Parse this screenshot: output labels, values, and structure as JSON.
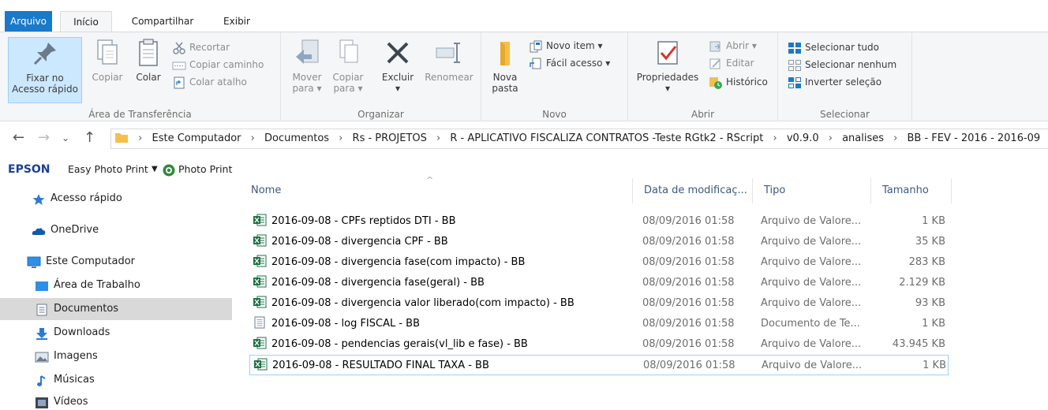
{
  "tabs": [
    "Arquivo",
    "Início",
    "Compartilhar",
    "Exibir"
  ],
  "ribbon": {
    "clipboard": {
      "pin": [
        "Fixar no",
        "Acesso rápido"
      ],
      "copy": "Copiar",
      "paste": "Colar",
      "cut": "Recortar",
      "copy_path": "Copiar caminho",
      "paste_shortcut": "Colar atalho",
      "label": "Área de Transferência"
    },
    "organize": {
      "move": [
        "Mover",
        "para ▾"
      ],
      "copy_to": [
        "Copiar",
        "para ▾"
      ],
      "delete": [
        "Excluir",
        "▾"
      ],
      "rename": "Renomear",
      "label": "Organizar"
    },
    "new": {
      "new_folder": [
        "Nova",
        "pasta"
      ],
      "new_item": "Novo item ▾",
      "easy_access": "Fácil acesso ▾",
      "label": "Novo"
    },
    "open": {
      "properties": [
        "Propriedades",
        "▾"
      ],
      "open": "Abrir ▾",
      "edit": "Editar",
      "history": "Histórico",
      "label": "Abrir"
    },
    "select": {
      "all": "Selecionar tudo",
      "none": "Selecionar nenhum",
      "invert": "Inverter seleção",
      "label": "Selecionar"
    }
  },
  "address": {
    "crumbs": [
      "Este Computador",
      "Documentos",
      "Rs - PROJETOS",
      "R - APLICATIVO FISCALIZA CONTRATOS -Teste RGtk2 - RScript",
      "v0.9.0",
      "analises",
      "BB - FEV - 2016 - 2016-09"
    ]
  },
  "epson": {
    "brand": "EPSON",
    "easy_photo": "Easy Photo Print",
    "photo_print": "Photo Print"
  },
  "nav": {
    "quick_access": "Acesso rápido",
    "onedrive": "OneDrive",
    "this_pc": "Este Computador",
    "desktop": "Área de Trabalho",
    "documents": "Documentos",
    "downloads": "Downloads",
    "images": "Imagens",
    "music": "Músicas",
    "videos": "Vídeos"
  },
  "columns": {
    "name": "Nome",
    "date": "Data de modificaç...",
    "type": "Tipo",
    "size": "Tamanho"
  },
  "files": [
    {
      "name": "2016-09-08 - CPFs reptidos DTI - BB",
      "date": "08/09/2016 01:58",
      "type": "Arquivo de Valore...",
      "size": "1 KB",
      "icon": "csv-excel-icon"
    },
    {
      "name": "2016-09-08 - divergencia CPF - BB",
      "date": "08/09/2016 01:58",
      "type": "Arquivo de Valore...",
      "size": "35 KB",
      "icon": "csv-excel-icon"
    },
    {
      "name": "2016-09-08 - divergencia fase(com impacto) - BB",
      "date": "08/09/2016 01:58",
      "type": "Arquivo de Valore...",
      "size": "283 KB",
      "icon": "csv-excel-icon"
    },
    {
      "name": "2016-09-08 - divergencia fase(geral) - BB",
      "date": "08/09/2016 01:58",
      "type": "Arquivo de Valore...",
      "size": "2.129 KB",
      "icon": "csv-excel-icon"
    },
    {
      "name": "2016-09-08 - divergencia valor liberado(com impacto) - BB",
      "date": "08/09/2016 01:58",
      "type": "Arquivo de Valore...",
      "size": "93 KB",
      "icon": "csv-excel-icon"
    },
    {
      "name": "2016-09-08 - log FISCAL - BB",
      "date": "08/09/2016 01:58",
      "type": "Documento de Te...",
      "size": "1 KB",
      "icon": "text-document-icon"
    },
    {
      "name": "2016-09-08 - pendencias gerais(vl_lib e fase) - BB",
      "date": "08/09/2016 01:58",
      "type": "Arquivo de Valore...",
      "size": "43.945 KB",
      "icon": "csv-excel-icon"
    },
    {
      "name": "2016-09-08 - RESULTADO FINAL TAXA - BB",
      "date": "08/09/2016 01:58",
      "type": "Arquivo de Valore...",
      "size": "1 KB",
      "icon": "csv-excel-icon"
    }
  ],
  "colors": {
    "file_tab": "#1979ca",
    "selection": "#cce8ff",
    "excel_green": "#1e7145"
  }
}
